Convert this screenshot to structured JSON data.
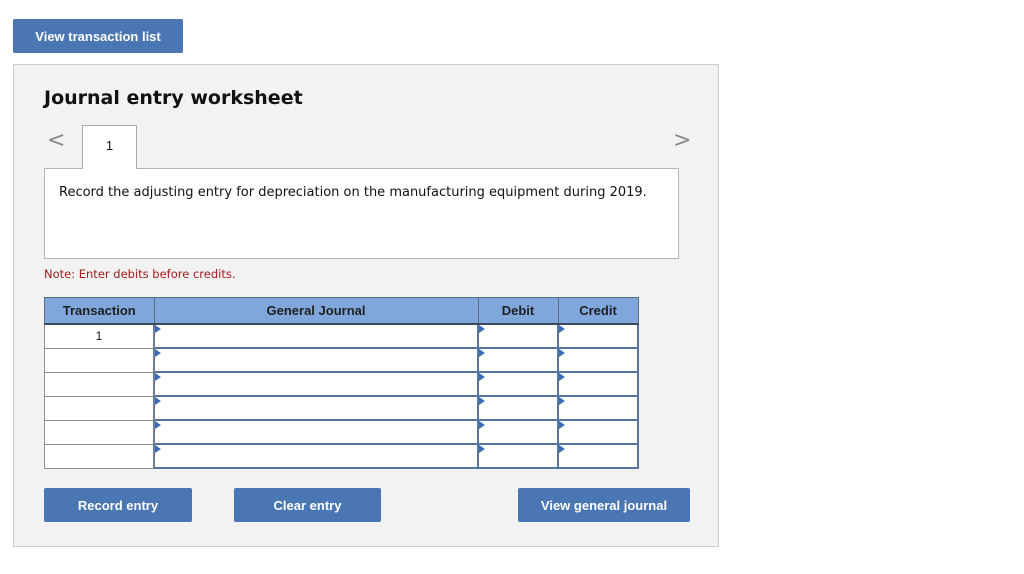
{
  "top_button": {
    "label": "View transaction list"
  },
  "worksheet": {
    "title": "Journal entry worksheet",
    "nav": {
      "prev_icon": "chevron-left-icon",
      "next_icon": "chevron-right-icon",
      "prev_glyph": "<",
      "next_glyph": ">"
    },
    "tabs": [
      {
        "label": "1",
        "active": true
      }
    ],
    "instruction": "Record the adjusting entry for depreciation on the manufacturing equipment during 2019.",
    "note": "Note: Enter debits before credits.",
    "table": {
      "headers": {
        "transaction": "Transaction",
        "general_journal": "General Journal",
        "debit": "Debit",
        "credit": "Credit"
      },
      "rows": [
        {
          "transaction": "1",
          "account": "",
          "debit": "",
          "credit": ""
        },
        {
          "transaction": "",
          "account": "",
          "debit": "",
          "credit": ""
        },
        {
          "transaction": "",
          "account": "",
          "debit": "",
          "credit": ""
        },
        {
          "transaction": "",
          "account": "",
          "debit": "",
          "credit": ""
        },
        {
          "transaction": "",
          "account": "",
          "debit": "",
          "credit": ""
        },
        {
          "transaction": "",
          "account": "",
          "debit": "",
          "credit": ""
        }
      ]
    },
    "buttons": {
      "record": "Record entry",
      "clear": "Clear entry",
      "view_journal": "View general journal"
    }
  },
  "colors": {
    "button": "#4a76b4",
    "header": "#7fa7dc",
    "note": "#a41a1a",
    "panel": "#f2f2f2"
  }
}
